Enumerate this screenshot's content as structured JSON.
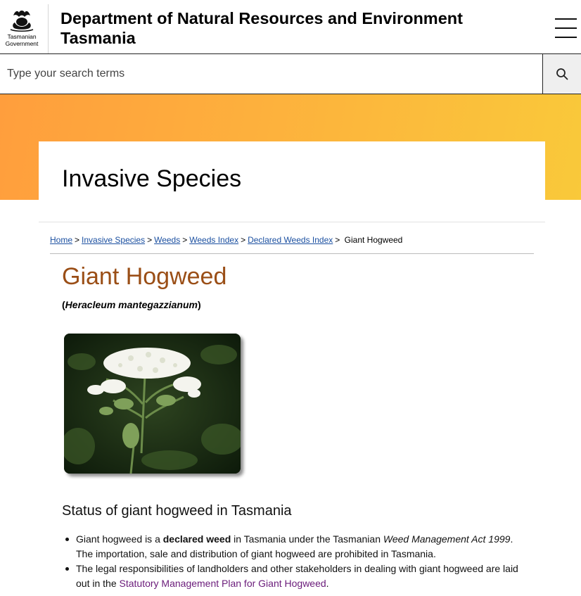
{
  "header": {
    "logo_line1": "Tasmanian",
    "logo_line2": "Government",
    "department_line1": "Department of Natural Resources and Environment",
    "department_line2": "Tasmania",
    "menu_icon": "hamburger-menu-icon"
  },
  "search": {
    "placeholder": "Type your search terms",
    "button_icon": "search-icon"
  },
  "banner": {
    "title": "Invasive Species",
    "gradient_start": "#ff9e3d",
    "gradient_end": "#f9c93a"
  },
  "breadcrumb": {
    "items": [
      "Home",
      "Invasive Species",
      "Weeds",
      "Weeds Index",
      "Declared Weeds Index"
    ],
    "current": "Giant Hogweed"
  },
  "page": {
    "title": "Giant Hogweed",
    "title_color": "#9a4e16",
    "scientific_name": "Heracleum mantegazzianum",
    "section_heading": "Status of giant hogweed in Tasmania",
    "bullet1": {
      "t1": "Giant hogweed is a ",
      "t2": "declared weed",
      "t3": " in Tasmania under the Tasmanian ",
      "t4": "Weed Management Act 1999",
      "t5": ". The importation, sale and distribution of giant hogweed are prohibited in Tasmania."
    },
    "bullet2": {
      "t1": "The legal responsibilities of landholders and other stakeholders in dealing with giant hogweed are laid out in the ",
      "link": "Statutory Management Plan for Giant Hogweed",
      "t2": "."
    }
  },
  "colors": {
    "link": "#1a4fa0",
    "visited_link": "#6a1b7a"
  }
}
